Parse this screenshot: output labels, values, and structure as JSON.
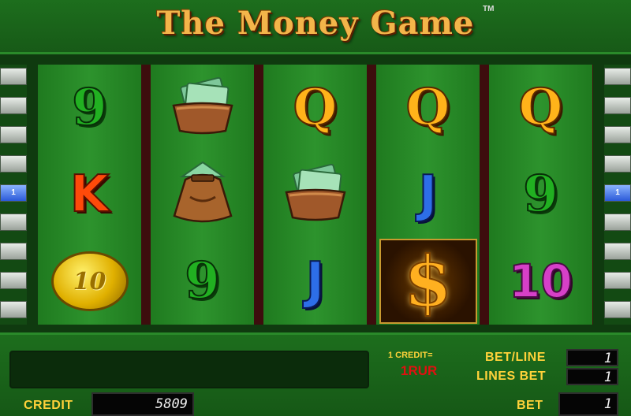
{
  "header": {
    "title": "The Money Game",
    "trademark": "TM"
  },
  "lines": {
    "left_label": "1",
    "right_label": "1"
  },
  "reels": [
    [
      {
        "symbol": "nine-icon",
        "text": "9"
      },
      {
        "symbol": "king-icon",
        "text": "K"
      },
      {
        "symbol": "coin-icon",
        "text": "10"
      }
    ],
    [
      {
        "symbol": "money-wallet-icon",
        "text": ""
      },
      {
        "symbol": "money-bag-icon",
        "text": ""
      },
      {
        "symbol": "nine-icon",
        "text": "9"
      }
    ],
    [
      {
        "symbol": "queen-icon",
        "text": "Q"
      },
      {
        "symbol": "money-wallet-icon",
        "text": ""
      },
      {
        "symbol": "jack-icon",
        "text": "J"
      }
    ],
    [
      {
        "symbol": "queen-icon",
        "text": "Q"
      },
      {
        "symbol": "jack-icon",
        "text": "J"
      },
      {
        "symbol": "dollar-icon",
        "text": "$"
      }
    ],
    [
      {
        "symbol": "queen-icon",
        "text": "Q"
      },
      {
        "symbol": "nine-icon",
        "text": "9"
      },
      {
        "symbol": "ten-icon",
        "text": "10"
      }
    ]
  ],
  "panel": {
    "credit_rate_label": "1 CREDIT=",
    "credit_rate_value": "1RUR",
    "bet_line_label": "BET/LINE",
    "bet_line_value": "1",
    "lines_bet_label": "LINES BET",
    "lines_bet_value": "1",
    "credit_label": "CREDIT",
    "credit_value": "5809",
    "bet_label": "BET",
    "bet_value": "1"
  }
}
